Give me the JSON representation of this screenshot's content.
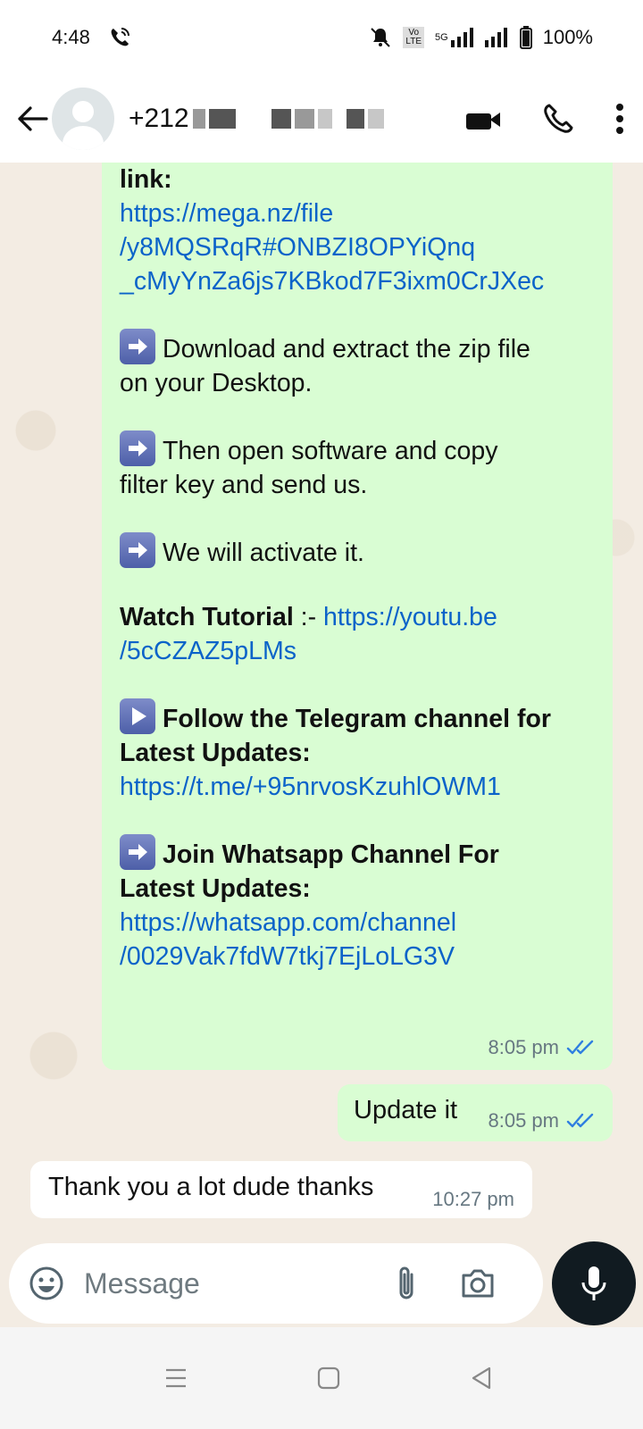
{
  "status_bar": {
    "time": "4:48",
    "battery_text": "100%",
    "network_label": "5G",
    "volte_label_top": "Vo",
    "volte_label_bottom": "LTE"
  },
  "header": {
    "contact_prefix": "+212",
    "icons": [
      "back-arrow-icon",
      "video-call-icon",
      "phone-icon",
      "more-vert-icon"
    ]
  },
  "messages": {
    "main": {
      "link_label": "link:",
      "link1_line1": "https://mega.nz/file",
      "link1_line2": "/y8MQSRqR#ONBZI8OPYiQnq",
      "link1_line3": "_cMyYnZa6js7KBkod7F3ixm0CrJXec",
      "step1_line1": "Download and extract the zip file",
      "step1_line2": "on your Desktop.",
      "step2_line1": "Then open software and copy",
      "step2_line2": "filter key and send us.",
      "step3": "We will activate it.",
      "tutorial_label": "Watch Tutorial",
      "tutorial_sep": " :- ",
      "tutorial_link_line1": "https://youtu.be",
      "tutorial_link_line2": "/5cCZAZ5pLMs",
      "telegram_line1": "Follow the Telegram channel for",
      "telegram_line2": "Latest Updates:",
      "telegram_link": "https://t.me/+95nrvosKzuhlOWM1",
      "whatsapp_line1": "Join Whatsapp Channel For",
      "whatsapp_line2": "Latest Updates:",
      "whatsapp_link_line1": "https://whatsapp.com/channel",
      "whatsapp_link_line2": "/0029Vak7fdW7tkj7EjLoLG3V",
      "time": "8:05 pm"
    },
    "update": {
      "text": "Update it",
      "time": "8:05 pm"
    },
    "incoming": {
      "text": "Thank you a lot dude thanks",
      "time": "10:27 pm"
    }
  },
  "composer": {
    "placeholder": "Message"
  },
  "colors": {
    "outgoing_bubble": "#d9fdd3",
    "incoming_bubble": "#ffffff",
    "link": "#0b63c9",
    "read_ticks": "#2f7fe0",
    "mic_button": "#111b21"
  }
}
